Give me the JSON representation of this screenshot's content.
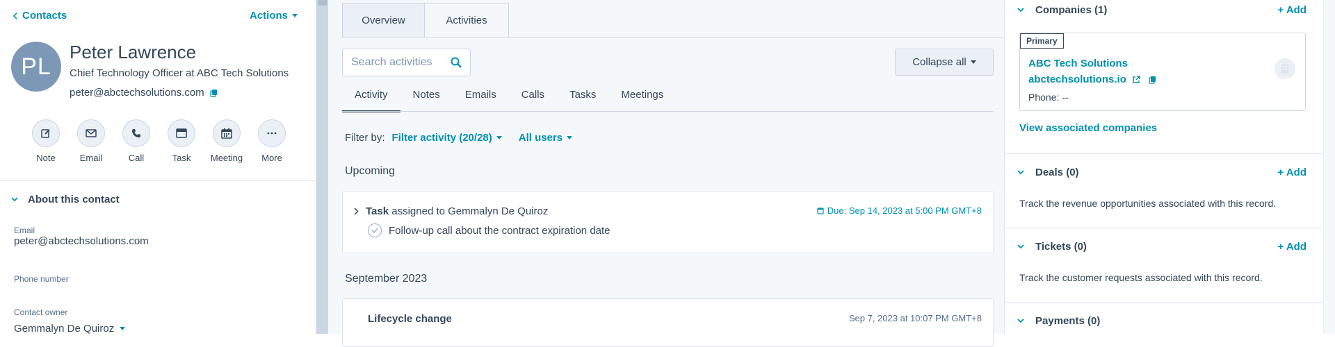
{
  "left": {
    "back_label": "Contacts",
    "actions_label": "Actions",
    "avatar_initials": "PL",
    "name": "Peter Lawrence",
    "job_title": "Chief Technology Officer at ABC Tech Solutions",
    "email": "peter@abctechsolutions.com",
    "quick_actions": [
      {
        "label": "Note",
        "icon": "edit-icon"
      },
      {
        "label": "Email",
        "icon": "envelope-icon"
      },
      {
        "label": "Call",
        "icon": "phone-icon"
      },
      {
        "label": "Task",
        "icon": "task-icon"
      },
      {
        "label": "Meeting",
        "icon": "calendar-icon"
      },
      {
        "label": "More",
        "icon": "more-icon"
      }
    ],
    "about_title": "About this contact",
    "properties": {
      "email_label": "Email",
      "email_value": "peter@abctechsolutions.com",
      "phone_label": "Phone number",
      "owner_label": "Contact owner",
      "owner_value": "Gemmalyn De Quiroz"
    }
  },
  "middle": {
    "tabs": [
      "Overview",
      "Activities"
    ],
    "active_tab": "Activities",
    "search_placeholder": "Search activities",
    "collapse_label": "Collapse all",
    "subtabs": [
      "Activity",
      "Notes",
      "Emails",
      "Calls",
      "Tasks",
      "Meetings"
    ],
    "active_subtab": "Activity",
    "filter_by_label": "Filter by:",
    "filter_activity": "Filter activity (20/28)",
    "all_users": "All users",
    "upcoming_title": "Upcoming",
    "task": {
      "type": "Task",
      "assigned_text": "assigned to Gemmalyn De Quiroz",
      "due": "Due: Sep 14, 2023 at 5:00 PM GMT+8",
      "title": "Follow-up call about the contract expiration date"
    },
    "month_title": "September 2023",
    "lifecycle": {
      "title": "Lifecycle change",
      "timestamp": "Sep 7, 2023 at 10:07 PM GMT+8"
    }
  },
  "right": {
    "companies": {
      "title": "Companies (1)",
      "add": "+ Add",
      "primary_badge": "Primary",
      "company_name": "ABC Tech Solutions",
      "domain": "abctechsolutions.io",
      "phone": "Phone: --",
      "view_associated": "View associated companies"
    },
    "deals": {
      "title": "Deals (0)",
      "add": "+ Add",
      "desc": "Track the revenue opportunities associated with this record."
    },
    "tickets": {
      "title": "Tickets (0)",
      "add": "+ Add",
      "desc": "Track the customer requests associated with this record."
    },
    "payments": {
      "title": "Payments (0)"
    }
  },
  "colors": {
    "accent": "#0091ae",
    "text": "#33475b",
    "avatar": "#7c98b6",
    "panel_bg": "#f5f8fa"
  }
}
